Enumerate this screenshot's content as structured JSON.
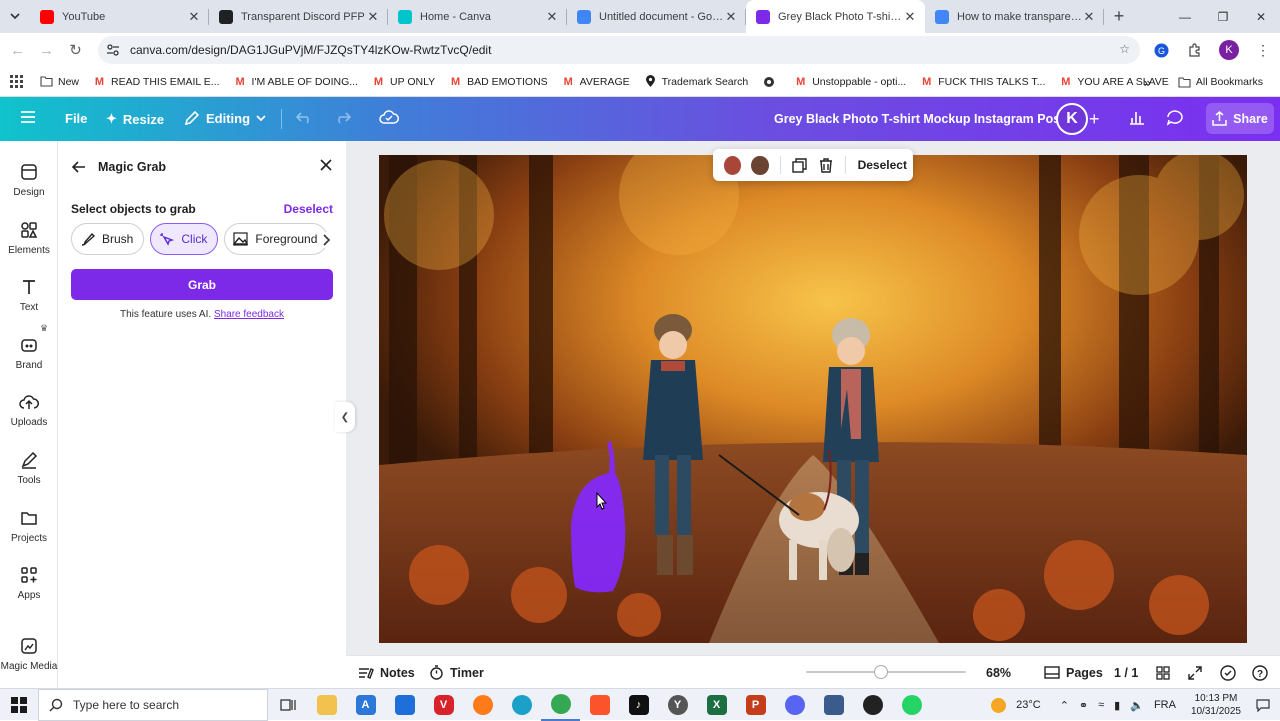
{
  "browser": {
    "tabs": [
      {
        "title": "YouTube",
        "favicon": "youtube-icon",
        "color": "#ff0000",
        "active": false
      },
      {
        "title": "Transparent Discord PFP",
        "favicon": "openai-icon",
        "color": "#202124",
        "active": false
      },
      {
        "title": "Home - Canva",
        "favicon": "canva-icon",
        "color": "#00c4cc",
        "active": false
      },
      {
        "title": "Untitled document - Google",
        "favicon": "docs-icon",
        "color": "#4285f4",
        "active": false
      },
      {
        "title": "Grey Black Photo T-shirt Mo",
        "favicon": "canva-icon",
        "color": "#7d2ae8",
        "active": true
      },
      {
        "title": "How to make transparent ba",
        "favicon": "google-icon",
        "color": "#4285f4",
        "active": false
      }
    ],
    "url": "canva.com/design/DAG1JGuPVjM/FJZQsTY4lzKOw-RwtzTvcQ/edit",
    "bookmarks": [
      {
        "label": "New",
        "icon": "folder-icon"
      },
      {
        "label": "READ THIS EMAIL E...",
        "icon": "gmail-icon"
      },
      {
        "label": "I'M ABLE OF DOING...",
        "icon": "gmail-icon"
      },
      {
        "label": "UP ONLY",
        "icon": "gmail-icon"
      },
      {
        "label": "BAD EMOTIONS",
        "icon": "gmail-icon"
      },
      {
        "label": "AVERAGE",
        "icon": "gmail-icon"
      },
      {
        "label": "Trademark Search",
        "icon": "location-icon"
      },
      {
        "label": "",
        "icon": "globe-icon"
      },
      {
        "label": "Unstoppable - opti...",
        "icon": "gmail-icon"
      },
      {
        "label": "FUCK THIS TALKS T...",
        "icon": "gmail-icon"
      },
      {
        "label": "YOU ARE A SLAVE",
        "icon": "gmail-icon"
      }
    ],
    "all_bookmarks": "All Bookmarks",
    "profile_initial": "K"
  },
  "canva": {
    "file": "File",
    "resize": "Resize",
    "editing": "Editing",
    "doc_title": "Grey Black Photo T-shirt Mockup Instagram Post",
    "avatar_initial": "K",
    "share": "Share",
    "brand_color": "#7d2ae8"
  },
  "rail": [
    {
      "label": "Design",
      "icon": "design-icon"
    },
    {
      "label": "Elements",
      "icon": "elements-icon"
    },
    {
      "label": "Text",
      "icon": "text-icon"
    },
    {
      "label": "Brand",
      "icon": "brand-icon"
    },
    {
      "label": "Uploads",
      "icon": "uploads-icon"
    },
    {
      "label": "Tools",
      "icon": "tools-icon"
    },
    {
      "label": "Projects",
      "icon": "projects-icon"
    },
    {
      "label": "Apps",
      "icon": "apps-icon"
    },
    {
      "label": "Magic Media",
      "icon": "magic-media-icon"
    }
  ],
  "panel": {
    "title": "Magic Grab",
    "select_label": "Select objects to grab",
    "deselect": "Deselect",
    "modes": [
      {
        "label": "Brush",
        "icon": "brush-icon",
        "active": false
      },
      {
        "label": "Click",
        "icon": "click-sparkle-icon",
        "active": true
      },
      {
        "label": "Foreground",
        "icon": "foreground-icon",
        "active": false
      }
    ],
    "grab": "Grab",
    "note": "This feature uses AI.",
    "feedback": "Share feedback"
  },
  "context_menu": {
    "swatches": [
      "#a8463a",
      "#6b4332"
    ],
    "deselect": "Deselect"
  },
  "bottom": {
    "notes": "Notes",
    "timer": "Timer",
    "zoom": "68%",
    "zoom_fraction": 0.47,
    "pages": "Pages",
    "page_count": "1 / 1"
  },
  "taskbar": {
    "search_placeholder": "Type here to search",
    "weather": "23°C",
    "language": "FRA",
    "time": "10:13 PM",
    "date": "10/31/2025"
  }
}
